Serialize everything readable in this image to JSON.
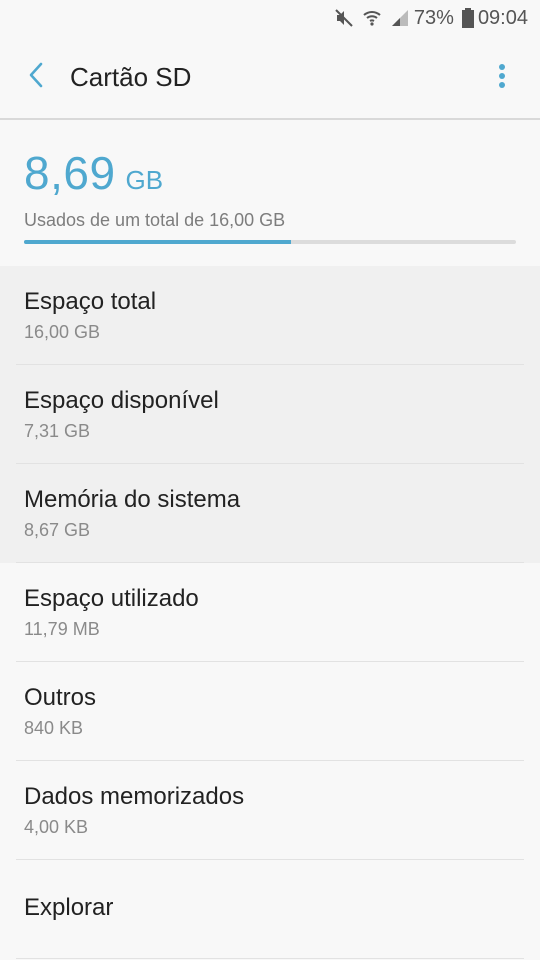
{
  "status_bar": {
    "battery_percent": "73%",
    "time": "09:04",
    "icons": [
      "mute-icon",
      "wifi-icon",
      "signal-icon",
      "battery-icon"
    ]
  },
  "header": {
    "title": "Cartão SD",
    "back_icon": "back-arrow-icon",
    "menu_icon": "more-vert-icon"
  },
  "storage": {
    "used_value": "8,69",
    "used_unit": "GB",
    "caption": "Usados de um total de 16,00 GB",
    "used_fraction": 0.543,
    "accent_color": "#4fa8cf"
  },
  "items": [
    {
      "label": "Espaço total",
      "value": "16,00 GB"
    },
    {
      "label": "Espaço disponível",
      "value": "7,31 GB"
    },
    {
      "label": "Memória do sistema",
      "value": "8,67 GB"
    },
    {
      "label": "Espaço utilizado",
      "value": "11,79 MB"
    },
    {
      "label": "Outros",
      "value": "840 KB"
    },
    {
      "label": "Dados memorizados",
      "value": "4,00 KB"
    },
    {
      "label": "Explorar"
    }
  ]
}
